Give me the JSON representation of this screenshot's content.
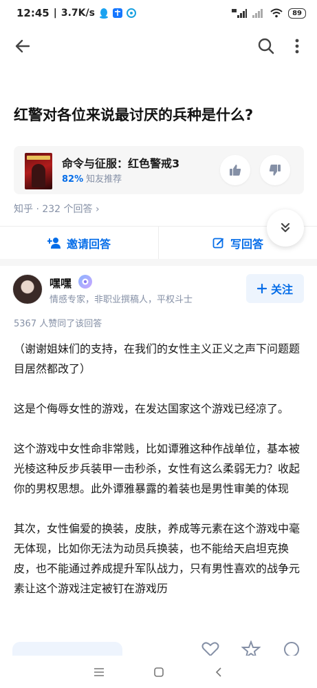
{
  "status_bar": {
    "time": "12:45",
    "speed": "3.7K/s",
    "battery": "89"
  },
  "question": {
    "title": "红警对各位来说最讨厌的兵种是什么?"
  },
  "topic_card": {
    "name": "命令与征服：红色警戒3",
    "recommend_percent": "82%",
    "recommend_text": "知友推荐"
  },
  "answers_link": "知乎 · 232 个回答 ›",
  "actions": {
    "invite_label": "邀请回答",
    "write_label": "写回答"
  },
  "answer": {
    "author_name": "嘿嘿",
    "author_bio": "情感专家，非职业撰稿人，平权斗士",
    "follow_label": "关注",
    "vote_text": "5367 人赞同了该回答",
    "paragraphs": [
      "（谢谢姐妹们的支持，在我们的女性主义正义之声下问题题目居然都改了）",
      "这是个侮辱女性的游戏，在发达国家这个游戏已经凉了。",
      "这个游戏中女性命非常贱，比如谭雅这种作战单位，基本被光棱这种反步兵装甲一击秒杀，女性有这么柔弱无力？收起你的男权思想。此外谭雅暴露的着装也是男性审美的体现",
      "其次，女性偏爱的换装，皮肤，养成等元素在这个游戏中毫无体现，比如你无法为动员兵换装，也不能给天启坦克换皮，也不能通过养成提升军队战力，只有男性喜欢的战争元素让这个游戏注定被钉在游戏历"
    ]
  },
  "colors": {
    "accent": "#056de8",
    "muted": "#8590a6",
    "card_bg": "#f6f6f6"
  },
  "icons": {
    "back": "arrow-left-icon",
    "search": "search-icon",
    "more": "more-vertical-icon",
    "thumb_up": "thumb-up-icon",
    "thumb_down": "thumb-down-icon",
    "expand": "chevrons-down-icon",
    "invite": "add-person-icon",
    "write": "edit-icon",
    "follow": "plus-icon"
  }
}
